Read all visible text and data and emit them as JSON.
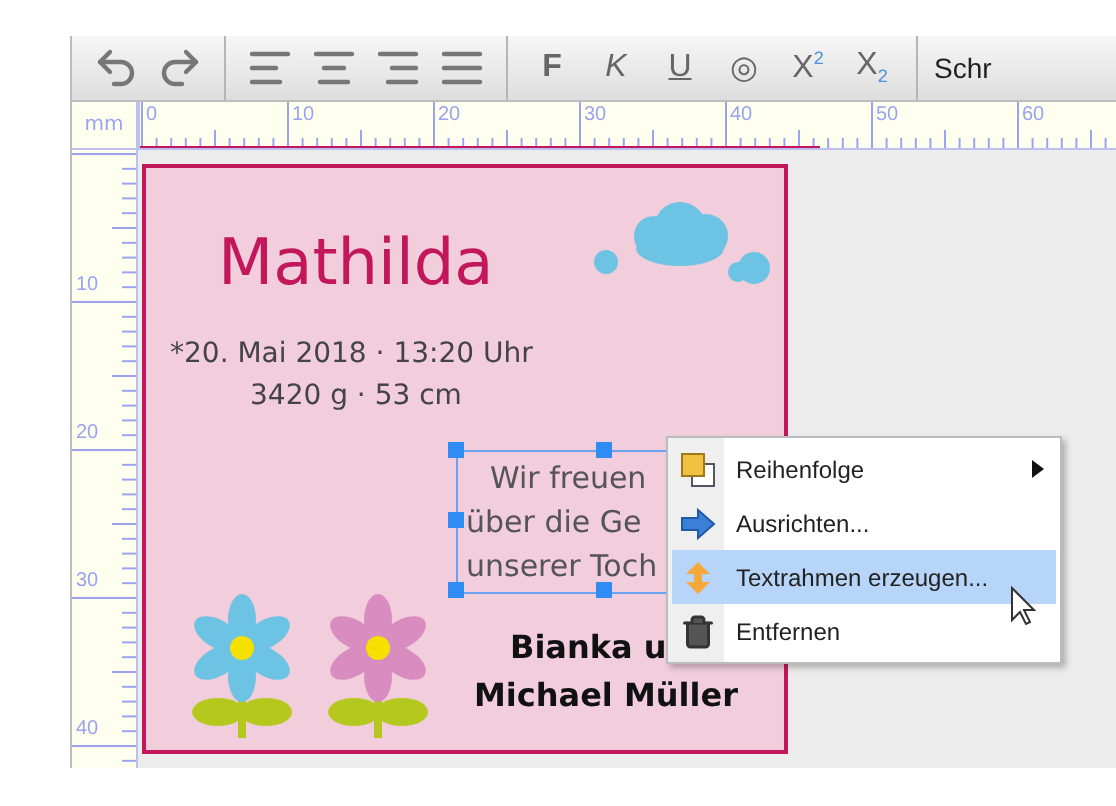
{
  "toolbar": {
    "groups": [
      [
        {
          "kind": "undo"
        },
        {
          "kind": "redo"
        }
      ],
      [
        {
          "kind": "align-left"
        },
        {
          "kind": "align-center"
        },
        {
          "kind": "align-right"
        },
        {
          "kind": "justify"
        }
      ],
      [
        {
          "kind": "bold",
          "label": "F"
        },
        {
          "kind": "italic",
          "label": "K"
        },
        {
          "kind": "underline",
          "label": "U"
        },
        {
          "kind": "outline",
          "label": "◎"
        },
        {
          "kind": "superscript",
          "label": "X$^{2}$"
        },
        {
          "kind": "subscript",
          "label": "X$_{2}$"
        }
      ]
    ],
    "font_field": "Schr"
  },
  "rulers": {
    "unit": "mm",
    "horizontal": [
      "0",
      "10",
      "20",
      "30",
      "40",
      "50",
      "60"
    ],
    "vertical": [
      "10",
      "20",
      "30",
      "40"
    ]
  },
  "card": {
    "title": "Mathilda",
    "date": "*20. Mai 2018 · 13:20 Uhr",
    "measures": "3420 g · 53 cm",
    "message": [
      "Wir freuen",
      "über die Ge",
      "unserer Toch"
    ],
    "signature": [
      "Bianka u",
      "Michael Müller"
    ]
  },
  "context_menu": [
    {
      "kind": "order",
      "label": "Reihenfolge",
      "submenu": true,
      "selected": false
    },
    {
      "kind": "align",
      "label": "Ausrichten...",
      "submenu": false,
      "selected": false
    },
    {
      "kind": "textframe",
      "label": "Textrahmen erzeugen...",
      "submenu": false,
      "selected": true
    },
    {
      "kind": "delete",
      "label": "Entfernen",
      "submenu": false,
      "selected": false
    }
  ]
}
